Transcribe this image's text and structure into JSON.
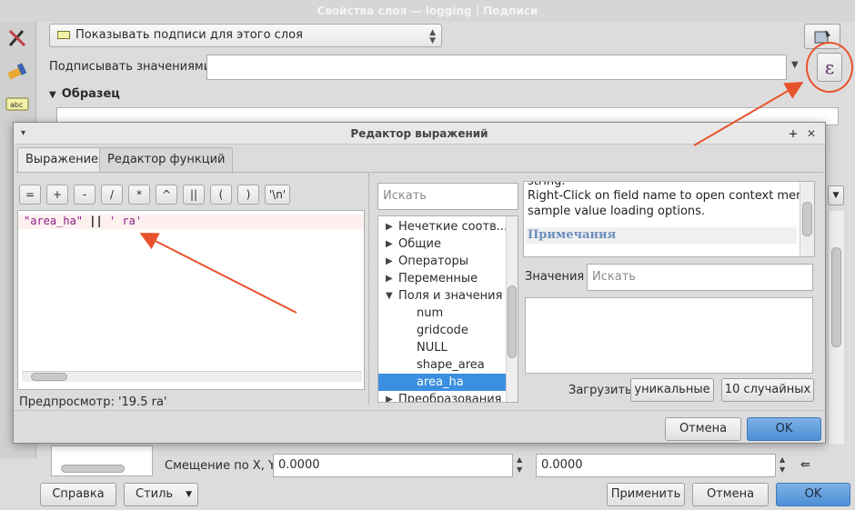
{
  "main": {
    "title": "Свойства слоя — logging | Подписи",
    "show_labels": "Показывать подписи для этого слоя",
    "label_with": "Подписывать значениями",
    "sample_title": "Образец",
    "offset_label": "Смещение по X, Y",
    "offset_x": "0.0000",
    "offset_y": "0.0000",
    "help_btn": "Справка",
    "style_btn": "Стиль",
    "apply_btn": "Применить",
    "cancel_btn": "Отмена",
    "ok_btn": "OK",
    "epsilon": "ε"
  },
  "expr": {
    "title": "Редактор выражений",
    "tab_expression": "Выражение",
    "tab_functions": "Редактор функций",
    "ops": [
      "=",
      "+",
      "-",
      "/",
      "*",
      "^",
      "||",
      "(",
      ")",
      "'\\n'"
    ],
    "code_field": "\"area_ha\"",
    "code_op": "||",
    "code_str": "' ra'",
    "search_placeholder": "Искать",
    "tree": [
      {
        "label": "Нечеткие соотв...",
        "kind": "group"
      },
      {
        "label": "Общие",
        "kind": "group"
      },
      {
        "label": "Операторы",
        "kind": "group"
      },
      {
        "label": "Переменные",
        "kind": "group"
      },
      {
        "label": "Поля и значения",
        "kind": "open"
      },
      {
        "label": "num",
        "kind": "leaf"
      },
      {
        "label": "gridcode",
        "kind": "leaf"
      },
      {
        "label": "NULL",
        "kind": "leaf"
      },
      {
        "label": "shape_area",
        "kind": "leaf"
      },
      {
        "label": "area_ha",
        "kind": "selected"
      },
      {
        "label": "Преобразования",
        "kind": "group"
      }
    ],
    "help_line0": "string.",
    "help_line1": "Right-Click on field name to open context menu",
    "help_line2": "sample value loading options.",
    "help_notes": "Примечания",
    "values_label": "Значения",
    "values_placeholder": "Искать",
    "load_label": "Загрузить",
    "unique_btn": "уникальные",
    "random_btn": "10 случайных",
    "preview": "Предпросмотр:  '19.5 ra'",
    "cancel_btn": "Отмена",
    "ok_btn": "OK",
    "pin_icon": "+",
    "close_icon": "✕",
    "menu_icon": "▾"
  },
  "colors": {
    "accent": "#4d8fd6",
    "selection": "#3b8fe0",
    "annotation": "#e8532b",
    "notes": "#6c8ebf"
  }
}
